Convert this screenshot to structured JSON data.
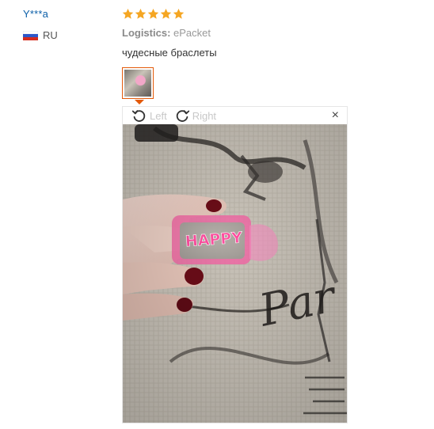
{
  "user": {
    "name": "Y***a",
    "country_code": "RU"
  },
  "feedback": {
    "rating": 5,
    "logistics_label": "Logistics:",
    "logistics_value": "ePacket",
    "text": "чудесные браслеты",
    "star_color": "#f5a623"
  },
  "viewer": {
    "rotate_left_label": "Left",
    "rotate_right_label": "Right",
    "close_symbol": "×",
    "photo_text": "HAPPY",
    "photo_background_text": "Par"
  },
  "colors": {
    "link": "#0b5fa8",
    "accent": "#e35a0a",
    "muted": "#999999"
  }
}
